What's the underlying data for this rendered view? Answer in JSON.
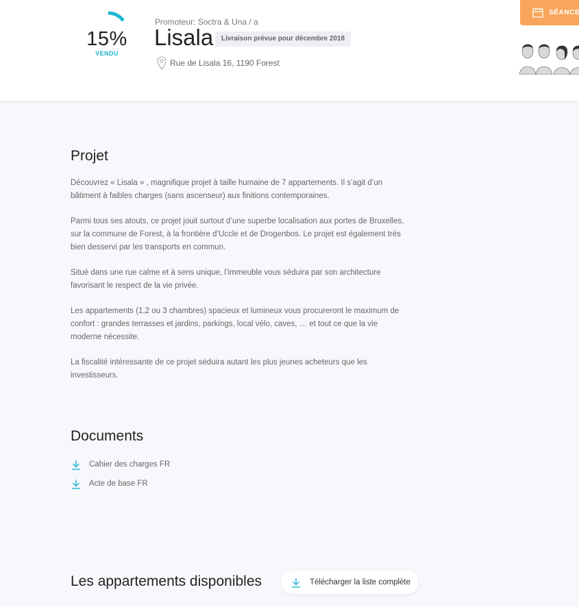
{
  "header": {
    "progress_value": 15,
    "progress_text": "15%",
    "progress_label": "VENDU",
    "promoter": "Promoteur: Soctra & Una / a",
    "title": "Lisala",
    "delivery": "Livraison prévue pour décembre 2018",
    "address": "Rue de Lisala 16, 1190 Forest",
    "cta_label": "SÉANCE",
    "accent_color": "#1fb6d3",
    "cta_color": "#f7a65b"
  },
  "projet": {
    "title": "Projet",
    "paragraphs": [
      "Découvrez « Lisala » , magnifique projet à taille humaine de 7 appartements. Il s’agit d’un bâtiment à faibles charges (sans ascenseur) aux finitions contemporaines.",
      "Parmi tous ses atouts, ce projet jouit surtout d’une superbe localisation aux portes de Bruxelles, sur la commune de Forest, à la frontière d’Uccle et de Drogenbos. Le projet est également très bien desservi par les transports en commun.",
      "Situé dans une rue calme et à sens unique, l’immeuble vous séduira par son architecture favorisant le respect de la vie privée.",
      "Les appartements (1,2 ou 3 chambres) spacieux et lumineux vous procureront le maximum de confort : grandes terrasses et jardins, parkings, local vélo, caves, … et tout ce que la vie moderne nécessite.",
      "La fiscalité intéressante de ce projet séduira autant les plus jeunes acheteurs que les investisseurs."
    ]
  },
  "documents": {
    "title": "Documents",
    "items": [
      "Cahier des charges FR",
      "Acte de base FR"
    ]
  },
  "appartements": {
    "title": "Les appartements disponibles",
    "download_label": "Télécharger la liste complète"
  }
}
